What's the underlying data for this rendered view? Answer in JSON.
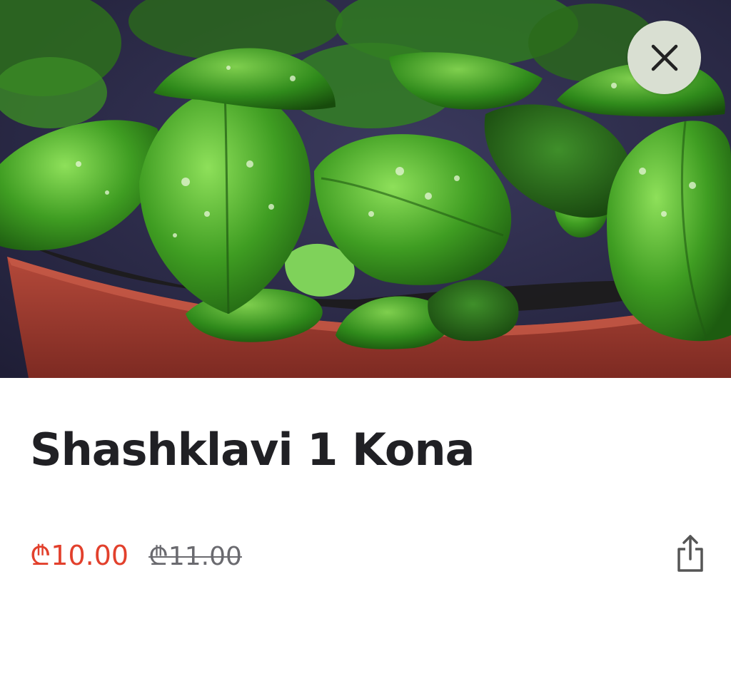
{
  "product": {
    "title": "Shashklavi 1 Kona",
    "image_description_icon": "basil-plant-photo",
    "price_current": "₾10.00",
    "price_old": "₾11.00"
  },
  "actions": {
    "close_icon": "close-icon",
    "share_icon": "share-icon"
  },
  "colors": {
    "price_current": "#e2402c",
    "price_old": "#6a6a6f",
    "title": "#202024",
    "close_bg": "#d9dfd2"
  }
}
